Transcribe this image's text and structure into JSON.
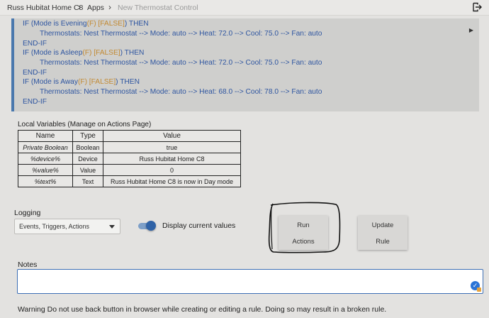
{
  "breadcrumb": {
    "hub": "Russ Hubitat Home C8",
    "apps": "Apps",
    "current": "New Thermostat Control"
  },
  "actions": [
    {
      "if_pre": "IF (Mode is Evening",
      "flag": "(F) [FALSE]",
      "if_post": ") THEN",
      "detail": "Thermostats: Nest Thermostat --> Mode: auto --> Heat: 72.0 --> Cool: 75.0 --> Fan: auto",
      "end": "END-IF"
    },
    {
      "if_pre": "IF (Mode is Asleep",
      "flag": "(F) [FALSE]",
      "if_post": ") THEN",
      "detail": "Thermostats: Nest Thermostat --> Mode: auto --> Heat: 72.0 --> Cool: 75.0 --> Fan: auto",
      "end": "END-IF"
    },
    {
      "if_pre": "IF (Mode is Away",
      "flag": "(F) [FALSE]",
      "if_post": ") THEN",
      "detail": "Thermostats: Nest Thermostat --> Mode: auto --> Heat: 68.0 --> Cool: 78.0 --> Fan: auto",
      "end": "END-IF"
    }
  ],
  "local_variables": {
    "title": "Local Variables",
    "subtitle": "(Manage on Actions Page)",
    "headers": [
      "Name",
      "Type",
      "Value"
    ],
    "rows": [
      {
        "name": "Private Boolean",
        "type": "Boolean",
        "value": "true"
      },
      {
        "name": "%device%",
        "type": "Device",
        "value": "Russ Hubitat Home C8"
      },
      {
        "name": "%value%",
        "type": "Value",
        "value": "0"
      },
      {
        "name": "%text%",
        "type": "Text",
        "value": "Russ Hubitat Home C8 is now in Day mode"
      }
    ]
  },
  "logging": {
    "label": "Logging",
    "selected": "Events, Triggers, Actions"
  },
  "display_toggle": {
    "label": "Display current values",
    "on": true
  },
  "buttons": {
    "run_line1": "Run",
    "run_line2": "Actions",
    "update_line1": "Update",
    "update_line2": "Rule"
  },
  "notes": {
    "label": "Notes",
    "value": ""
  },
  "warning": {
    "bold": "Warning",
    "text": "Do not use back button in browser while creating or editing a rule. Doing so may result in a broken rule."
  },
  "colors": {
    "accent": "#2f62a6",
    "action_text": "#2e55a0",
    "flag_text": "#c28a34",
    "background": "#e3e2e0"
  }
}
